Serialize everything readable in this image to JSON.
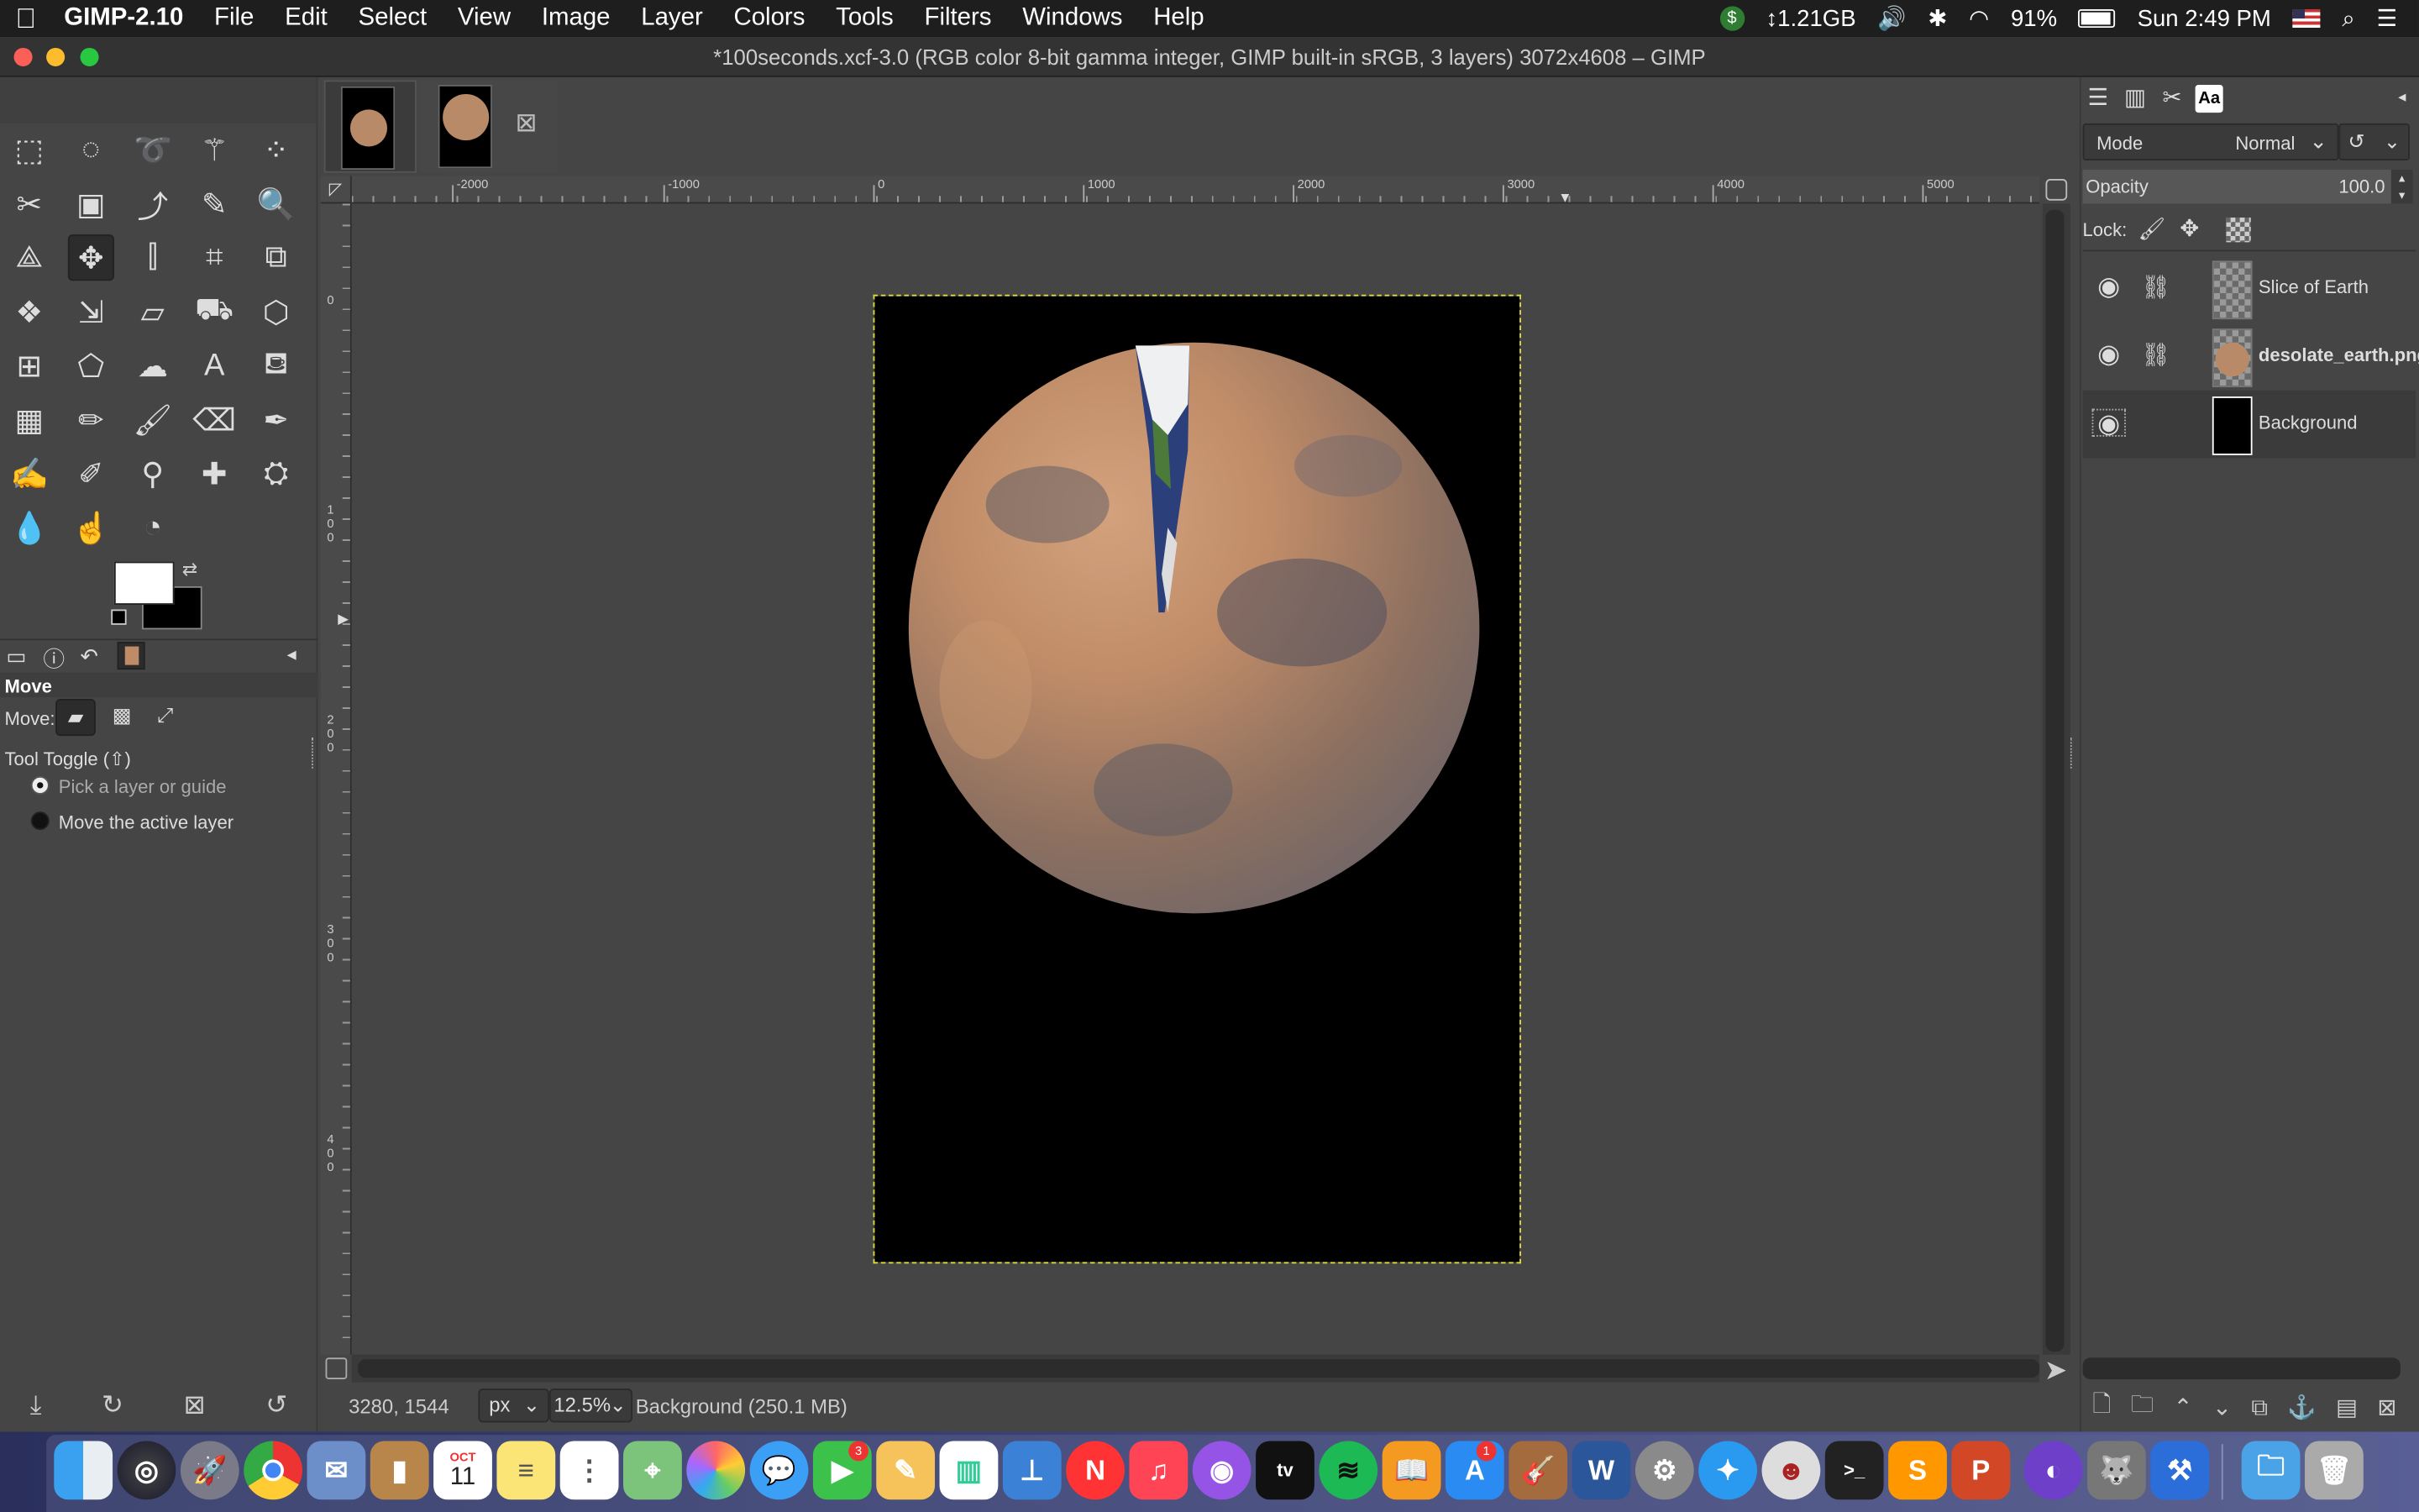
{
  "menubar": {
    "app_name": "GIMP-2.10",
    "items": [
      "File",
      "Edit",
      "Select",
      "View",
      "Image",
      "Layer",
      "Colors",
      "Tools",
      "Filters",
      "Windows",
      "Help"
    ],
    "memory": "1.21GB",
    "battery": "91%",
    "clock": "Sun 2:49 PM"
  },
  "window": {
    "title": "*100seconds.xcf-3.0 (RGB color 8-bit gamma integer, GIMP built-in sRGB, 3 layers) 3072x4608 – GIMP"
  },
  "tool_options": {
    "title": "Move",
    "move_label": "Move:",
    "toggle_label": "Tool Toggle  (⇧)",
    "option1": "Pick a layer or guide",
    "option2": "Move the active layer"
  },
  "ruler_top": [
    "-2000",
    "-1000",
    "0",
    "1000",
    "2000",
    "3000",
    "4000",
    "5000"
  ],
  "ruler_left": [
    "0",
    "100",
    "200",
    "300",
    "400"
  ],
  "statusbar": {
    "coords": "3280, 1544",
    "unit": "px",
    "zoom": "12.5%",
    "info": "Background (250.1 MB)"
  },
  "layers_panel": {
    "mode_label": "Mode",
    "mode_value": "Normal",
    "opacity_label": "Opacity",
    "opacity_value": "100.0",
    "lock_label": "Lock:",
    "layers": [
      {
        "name": "Slice of Earth"
      },
      {
        "name": "desolate_earth.png"
      },
      {
        "name": "Background"
      }
    ]
  },
  "dock_calendar": {
    "month": "OCT",
    "day": "11"
  },
  "dock_badges": {
    "facetime": "3",
    "appstore": "1"
  },
  "colors": {
    "accent_selection": "#e0d93a",
    "menubar": "#1e1e1e",
    "panel": "#454545"
  }
}
